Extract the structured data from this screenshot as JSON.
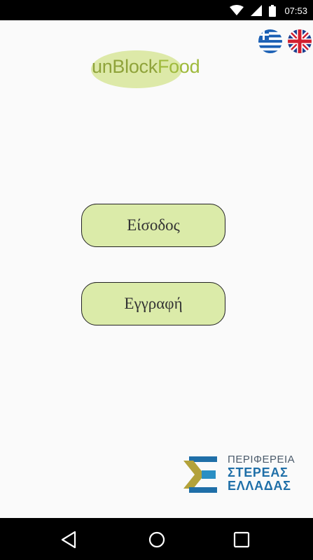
{
  "status_bar": {
    "time": "07:53",
    "icons": [
      "wifi-icon",
      "signal-icon",
      "battery-icon"
    ]
  },
  "language_flags": [
    "greece-flag-icon",
    "uk-flag-icon"
  ],
  "logo": {
    "part1": "unBlock",
    "part2": "Food"
  },
  "buttons": {
    "login": "Είσοδος",
    "register": "Εγγραφή"
  },
  "region": {
    "line1": "ΠΕΡΙΦΕΡΕΙΑ",
    "line2": "ΣΤΕΡΕΑΣ",
    "line3": "ΕΛΛΑΔΑΣ"
  },
  "nav_bar": [
    "back-icon",
    "home-icon",
    "recents-icon"
  ],
  "colors": {
    "button_bg": "#dbeba9",
    "logo_green": "#9fba3c",
    "region_blue": "#1f6fa8"
  }
}
